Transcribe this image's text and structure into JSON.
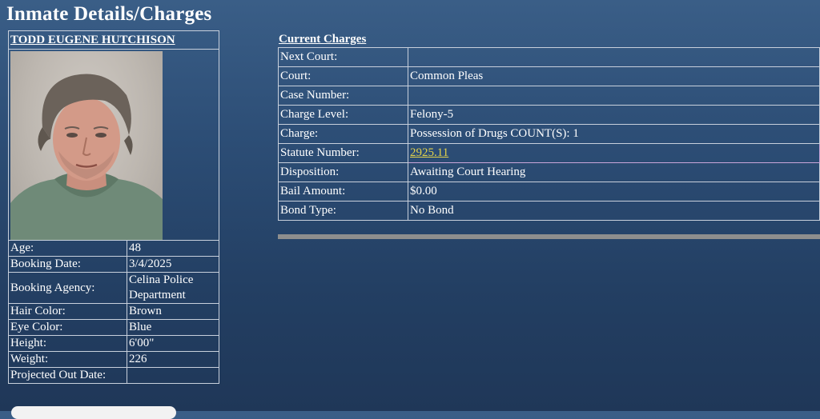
{
  "page": {
    "title": "Inmate Details/Charges"
  },
  "inmate": {
    "name": "TODD EUGENE HUTCHISON",
    "details": [
      {
        "label": "Age:",
        "value": "48"
      },
      {
        "label": "Booking Date:",
        "value": "3/4/2025"
      },
      {
        "label": "Booking Agency:",
        "value": "Celina Police Department"
      },
      {
        "label": "Hair Color:",
        "value": "Brown"
      },
      {
        "label": "Eye Color:",
        "value": "Blue"
      },
      {
        "label": "Height:",
        "value": "6'00\""
      },
      {
        "label": "Weight:",
        "value": "226"
      },
      {
        "label": "Projected Out Date:",
        "value": ""
      }
    ]
  },
  "charges": {
    "heading": "Current Charges",
    "rows": [
      {
        "label": "Next Court:",
        "value": ""
      },
      {
        "label": "Court:",
        "value": "Common Pleas"
      },
      {
        "label": "Case Number:",
        "value": ""
      },
      {
        "label": "Charge Level:",
        "value": "Felony-5"
      },
      {
        "label": "Charge:",
        "value": "Possession of Drugs  COUNT(S): 1"
      },
      {
        "label": "Statute Number:",
        "value": "2925.11"
      },
      {
        "label": "Disposition:",
        "value": "Awaiting Court Hearing"
      },
      {
        "label": "Bail Amount:",
        "value": "$0.00"
      },
      {
        "label": "Bond Type:",
        "value": "No Bond"
      }
    ]
  },
  "colors": {
    "background": "#2c4d75",
    "border": "#c8d0dc",
    "link": "#e3d24a",
    "divider": "#8e8e8e"
  }
}
